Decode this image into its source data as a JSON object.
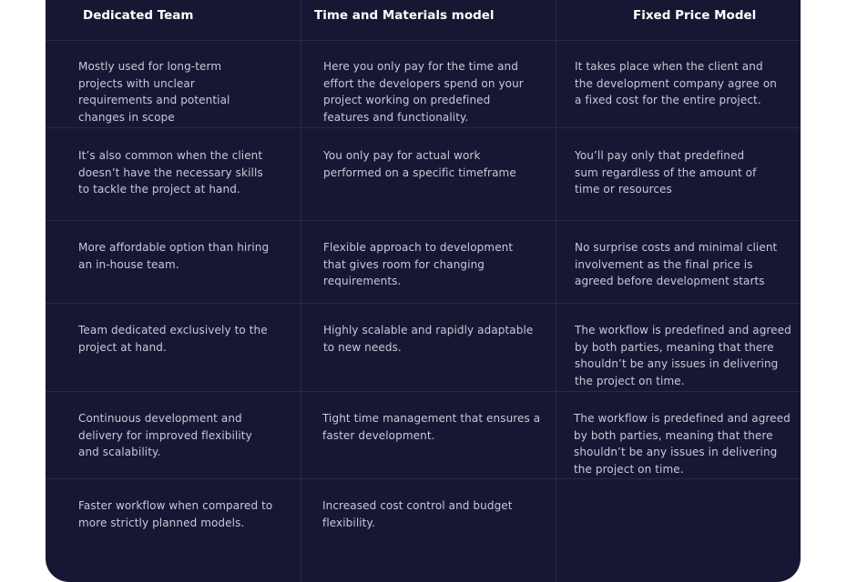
{
  "table": {
    "headers": [
      "Dedicated Team",
      "Time and Materials model",
      "Fixed Price Model"
    ],
    "rows": [
      [
        "Mostly used for long-term projects with unclear requirements and potential changes in scope",
        "Here you only pay for the time and effort the developers spend on your project working on predefined features and functionality.",
        "It takes place when the client and the development company agree on a fixed cost for the entire project."
      ],
      [
        "It’s also common when the client doesn’t have the necessary skills to tackle the project at hand.",
        "You only pay for actual work performed on a specific timeframe",
        "You’ll pay only that predefined sum regardless of the amount of time or resources"
      ],
      [
        "More affordable option than hiring an in-house team.",
        "Flexible approach to development that gives room for changing requirements.",
        "No surprise costs and minimal client involvement as the final price is agreed before development starts"
      ],
      [
        "Team dedicated exclusively to the project at hand.",
        "Highly scalable and rapidly adaptable to new needs.",
        "The workflow is predefined and agreed by both parties, meaning that there shouldn’t be any issues in delivering the project on time."
      ],
      [
        "Continuous development and delivery for improved flexibility and scalability.",
        "Tight time management that ensures a faster development.",
        "The workflow is predefined and agreed by both parties, meaning that there shouldn’t be any issues in delivering the project on time."
      ],
      [
        "Faster workflow when compared to more strictly planned models.",
        "Increased cost control and budget flexibility.",
        ""
      ]
    ]
  }
}
